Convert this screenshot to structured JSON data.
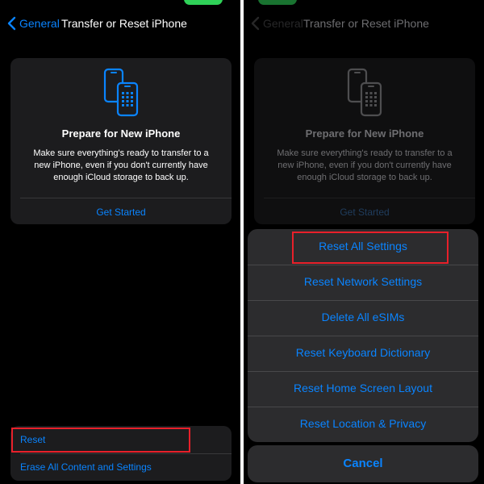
{
  "colors": {
    "accent": "#0a84ff",
    "background": "#000000",
    "card": "#1c1c1e",
    "sheet": "#2c2c2e",
    "highlight": "#e8202a"
  },
  "nav": {
    "back_label": "General",
    "title": "Transfer or Reset iPhone"
  },
  "card": {
    "icon": "two-phones-icon",
    "title": "Prepare for New iPhone",
    "text": "Make sure everything's ready to transfer to a new iPhone, even if you don't currently have enough iCloud storage to back up.",
    "link": "Get Started"
  },
  "reset_group": {
    "reset_label": "Reset",
    "erase_label": "Erase All Content and Settings"
  },
  "action_sheet": {
    "items": [
      "Reset All Settings",
      "Reset Network Settings",
      "Delete All eSIMs",
      "Reset Keyboard Dictionary",
      "Reset Home Screen Layout",
      "Reset Location & Privacy"
    ],
    "cancel_label": "Cancel",
    "peek_label": "Reset"
  }
}
